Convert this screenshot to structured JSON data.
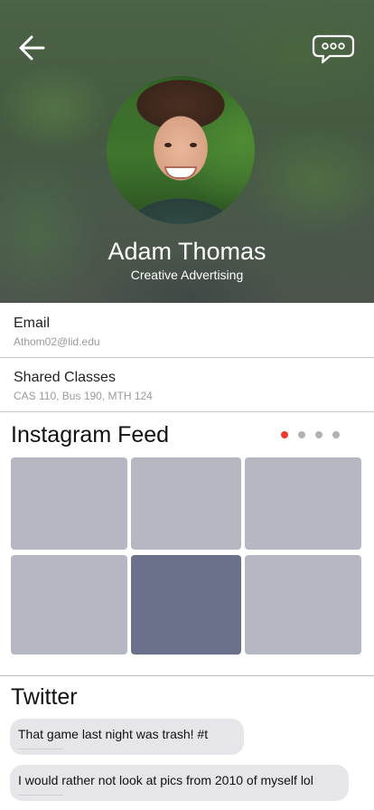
{
  "header": {
    "back_icon": "arrow-left-icon",
    "chat_icon": "chat-bubble-ellipsis-icon",
    "name": "Adam Thomas",
    "subtitle": "Creative Advertising"
  },
  "info": {
    "email_label": "Email",
    "email_value": "Athom02@lid.edu",
    "classes_label": "Shared Classes",
    "classes_value": "CAS 110, Bus 190, MTH 124"
  },
  "instagram": {
    "title": "Instagram Feed",
    "pager": {
      "count": 4,
      "active_index": 0
    },
    "colors": {
      "tile": "#b5b8c3",
      "tile_dark": "#6a718a",
      "dot_active": "#f03a2e",
      "dot": "#b2b2b2"
    }
  },
  "twitter": {
    "title": "Twitter",
    "tweets": [
      {
        "text": "That game last night was trash! #t"
      },
      {
        "text": "I would rather not look at pics from 2010 of myself lol"
      }
    ]
  }
}
